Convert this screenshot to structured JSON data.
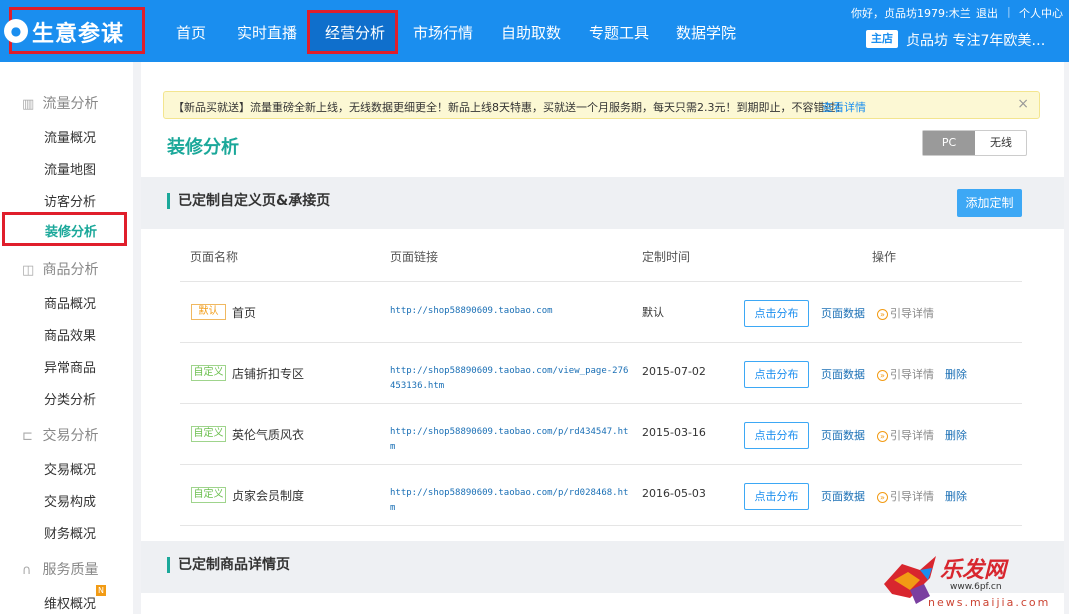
{
  "app": {
    "logo_text": "生意参谋"
  },
  "nav": [
    "首页",
    "实时直播",
    "经营分析",
    "市场行情",
    "自助取数",
    "专题工具",
    "数据学院"
  ],
  "topbar": {
    "greeting": "你好，贞品坊1979:木兰",
    "logout": "退出",
    "personal_center": "个人中心",
    "shop_badge": "主店",
    "shop_name": "贞品坊  专注7年欧美…"
  },
  "sidebar": {
    "groups": [
      {
        "title": "流量分析",
        "icon": "bar-chart-icon",
        "items": [
          "流量概况",
          "流量地图",
          "访客分析",
          "装修分析"
        ]
      },
      {
        "title": "商品分析",
        "icon": "bag-icon",
        "items": [
          "商品概况",
          "商品效果",
          "异常商品",
          "分类分析"
        ]
      },
      {
        "title": "交易分析",
        "icon": "cart-icon",
        "items": [
          "交易概况",
          "交易构成",
          "财务概况"
        ]
      },
      {
        "title": "服务质量",
        "icon": "headset-icon",
        "items": [
          "维权概况"
        ]
      }
    ],
    "active_item": "装修分析",
    "new_badge": "N"
  },
  "notice": {
    "text": "【新品买就送】流量重磅全新上线，无线数据更细更全！新品上线8天特惠，买就送一个月服务期，每天只需2.3元！到期即止，不容错过！",
    "link": "查看详情",
    "close": "×"
  },
  "page": {
    "title": "装修分析",
    "toggle": {
      "pc": "PC",
      "wireless": "无线",
      "selected": "PC"
    }
  },
  "section1": {
    "title": "已定制自定义页&承接页",
    "add_button": "添加定制",
    "columns": [
      "页面名称",
      "页面链接",
      "定制时间",
      "操作"
    ],
    "rows": [
      {
        "tag": "默认",
        "name": "首页",
        "link": "http://shop58890609.taobao.com",
        "date": "默认",
        "distribute": "点击分布",
        "data": "页面数据",
        "guide": "引导详情",
        "delete": ""
      },
      {
        "tag": "自定义",
        "name": "店铺折扣专区",
        "link": "http://shop58890609.taobao.com/view_page-276453136.htm",
        "date": "2015-07-02",
        "distribute": "点击分布",
        "data": "页面数据",
        "guide": "引导详情",
        "delete": "删除"
      },
      {
        "tag": "自定义",
        "name": "英伦气质风衣",
        "link": "http://shop58890609.taobao.com/p/rd434547.htm",
        "date": "2015-03-16",
        "distribute": "点击分布",
        "data": "页面数据",
        "guide": "引导详情",
        "delete": "删除"
      },
      {
        "tag": "自定义",
        "name": "贞家会员制度",
        "link": "http://shop58890609.taobao.com/p/rd028468.htm",
        "date": "2016-05-03",
        "distribute": "点击分布",
        "data": "页面数据",
        "guide": "引导详情",
        "delete": "删除"
      }
    ]
  },
  "section2": {
    "title": "已定制商品详情页"
  },
  "watermark": {
    "brand": "乐发网",
    "url": "www.6pf.cn",
    "url2": "news.maijia.com"
  },
  "colors": {
    "primary": "#1a8eef",
    "accent_teal": "#1ba89a",
    "highlight_red": "#e01e2b",
    "tag_default": "#f29b14",
    "tag_custom": "#6bbf4e"
  }
}
